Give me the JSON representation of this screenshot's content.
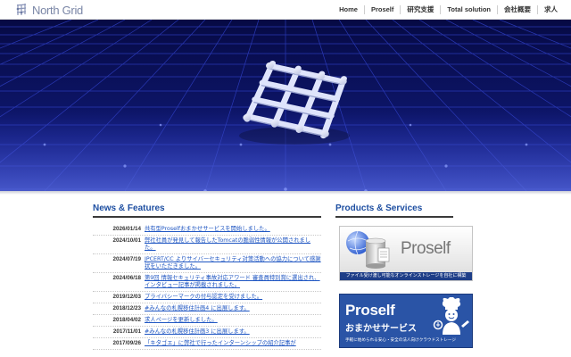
{
  "header": {
    "logo_text": "North Grid",
    "nav": [
      "Home",
      "Proself",
      "研究支援",
      "Total solution",
      "会社概要",
      "求人"
    ]
  },
  "hero": {
    "background_color": "#0b1158",
    "grid_color": "#2e3cc0"
  },
  "news": {
    "title": "News & Features",
    "items": [
      {
        "date": "2026/01/14",
        "text": "共有型Proselfおまかせサービスを開始しました。"
      },
      {
        "date": "2024/10/01",
        "text": "弊社社員が発見して報告したTomcatの脆弱性情報が公開されました。"
      },
      {
        "date": "2024/07/19",
        "text": "JPCERT/CC よりサイバーセキュリティ対策活動への協力について感謝状をいただきました。"
      },
      {
        "date": "2024/06/18",
        "text": "第9回 情報セキュリティ事故対応アワード 審査員特別賞に選出され、インタビュー記事が掲載されました。"
      },
      {
        "date": "2019/12/03",
        "text": "プライバシーマークの付与認定を受けました。"
      },
      {
        "date": "2018/12/23",
        "text": "#みんなの札幌移住計画4 に出展します。"
      },
      {
        "date": "2018/04/02",
        "text": "求人ページを更新しました。"
      },
      {
        "date": "2017/11/01",
        "text": "#みんなの札幌移住計画3 に出展します。"
      },
      {
        "date": "2017/09/26",
        "text": "「キタゴエ」に弊社で行ったインターンシップの紹介記事が"
      }
    ]
  },
  "products": {
    "title": "Products & Services",
    "banner1": {
      "word": "Proself",
      "caption": "ファイル受け渡し可能なオンラインストレージを自社に構築"
    },
    "banner2": {
      "title": "Proself",
      "subtitle": "おまかせサービス",
      "caption": "手軽に始められる安心・安全の法人向けクラウドストレージ"
    }
  }
}
